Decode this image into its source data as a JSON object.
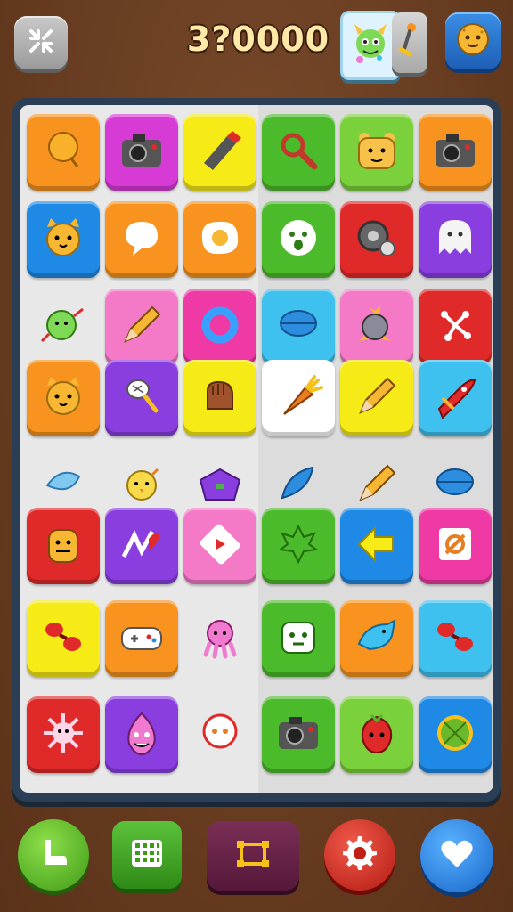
{
  "score": "3?0000",
  "colors": {
    "orange": "#f7931e",
    "magenta": "#d63bd6",
    "yellow": "#f6ea17",
    "green": "#4cbb2b",
    "lime": "#7bd13b",
    "blue": "#1f8ae6",
    "red": "#e02a2a",
    "purple": "#8a3ee0",
    "pink": "#f47ac7",
    "hotpink": "#ef3aa6",
    "cyan": "#3fc1ef"
  },
  "bottom_buttons": [
    "resume-button",
    "grid-button",
    "crop-button",
    "settings-button",
    "favorite-button"
  ],
  "board_rows": [
    [
      "balloon",
      "camera",
      "marker",
      "magnifier",
      "bear-face",
      "camera"
    ],
    [
      "cat-face",
      "speech-bubble",
      "fried-egg",
      "face",
      "gear-disc",
      "ghost"
    ],
    [
      "bean-creature",
      "pencil",
      "swirl-ring",
      "bowl",
      "bird-knight",
      "network"
    ],
    [
      "cat-face",
      "racket",
      "fist",
      "carrot",
      "pencil",
      "rocket"
    ],
    [
      "leaf",
      "chick",
      "purse",
      "feather",
      "pencil",
      "bowl"
    ],
    [
      "mask",
      "chart",
      "play",
      "maple-leaf",
      "arrow-left",
      "target"
    ],
    [
      "maracas",
      "controller",
      "octopus",
      "robot-face",
      "dolphin",
      "maracas"
    ],
    [
      "spiky-ball",
      "onion-face",
      "face-bubble",
      "camera",
      "strawberry",
      "melon"
    ]
  ]
}
